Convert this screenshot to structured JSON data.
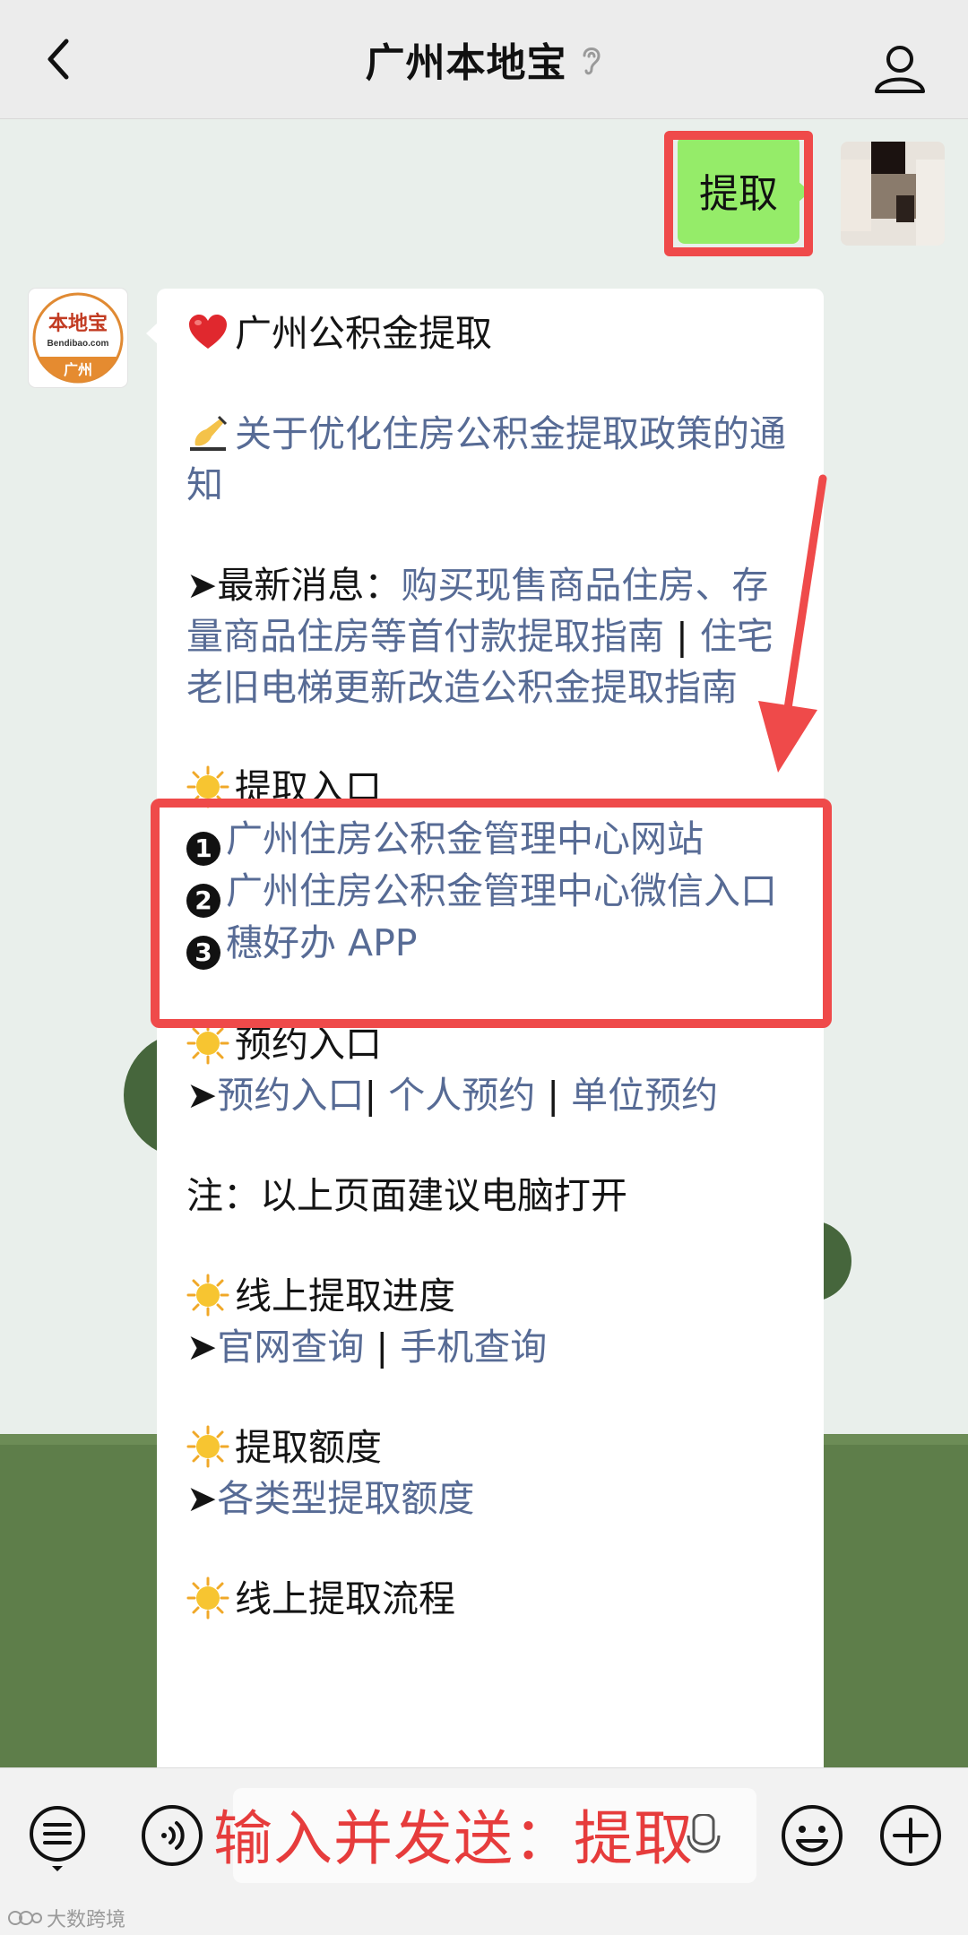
{
  "header": {
    "title": "广州本地宝"
  },
  "outgoing": {
    "text": "提取"
  },
  "logo": {
    "main": "本地宝",
    "domain": "Bendibao.com",
    "city": "广州"
  },
  "message": {
    "title": "广州公积金提取",
    "notice_link": "关于优化住房公积金提取政策的通知",
    "news_label": "➤最新消息：",
    "news_link1": "购买现售商品住房、存量商品住房等首付款提取指南",
    "news_sep": " | ",
    "news_link2": "住宅老旧电梯更新改造公积金提取指南",
    "entry_heading": "提取入口",
    "entry_items": [
      {
        "num": "1",
        "text": "广州住房公积金管理中心网站"
      },
      {
        "num": "2",
        "text": "广州住房公积金管理中心微信入口"
      },
      {
        "num": "3",
        "text": "穗好办 APP"
      }
    ],
    "booking_heading": "预约入口",
    "booking_arrow": "➤",
    "booking_link1": "预约入口",
    "booking_sep1": "| ",
    "booking_link2": "个人预约",
    "booking_sep2": " | ",
    "booking_link3": "单位预约",
    "note": "注：以上页面建议电脑打开",
    "progress_heading": "线上提取进度",
    "progress_arrow": "➤",
    "progress_link1": "官网查询",
    "progress_sep": " | ",
    "progress_link2": "手机查询",
    "amount_heading": "提取额度",
    "amount_arrow": "➤",
    "amount_link": "各类型提取额度",
    "flow_heading": "线上提取流程"
  },
  "bottom": {
    "send_hint": "输入并发送：提取"
  },
  "watermark": {
    "text": "大数跨境"
  },
  "colors": {
    "link": "#576b95",
    "highlight": "#ef4a4a",
    "outgoing_bubble": "#95ec69",
    "hint": "#e63c3c"
  }
}
